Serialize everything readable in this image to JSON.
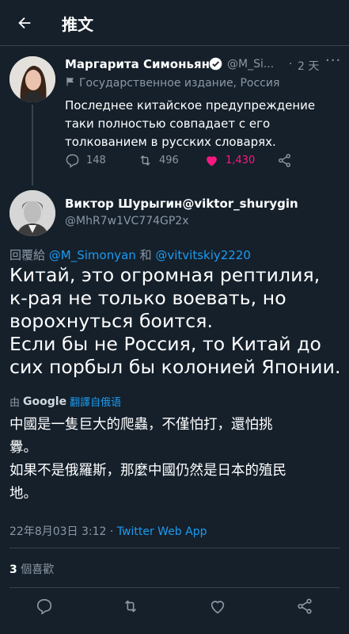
{
  "header": {
    "title": "推文"
  },
  "parent_tweet": {
    "author_name": "Маргарита Симоньян",
    "handle": "@M_Si...",
    "dot": "·",
    "time": "2 天",
    "more": "···",
    "label": "Государственное издание, Россия",
    "text": "Последнее китайское предупреждение таки полностью совпадает с его толкованием в русских словарях.",
    "replies": "148",
    "retweets": "496",
    "likes": "1,430"
  },
  "main_tweet": {
    "author_name": "Виктор Шурыгин@viktor_shurygin",
    "handle": "@MhR7w1VC774GP2x",
    "reply_prefix": "回覆給 ",
    "reply_user1": "@M_Simonyan",
    "reply_and": " 和 ",
    "reply_user2": "@vitvitskiy2220",
    "text_line1": "Китай, это огромная рептилия,",
    "text_line2": "к-рая не только воевать, но",
    "text_line3": "ворохнуться боится.",
    "text_line4": "Если бы не Россия, то Китай до",
    "text_line5": "сих порбыл бы колонией Японии.",
    "translated_by": "由",
    "google": "Google",
    "translate_link": "翻譯自俄语",
    "trans_line1": "中國是一隻巨大的爬蟲，不僅怕打，還怕挑",
    "trans_line2": "釁。",
    "trans_line3": "如果不是俄羅斯，那麼中國仍然是日本的殖民",
    "trans_line4": "地。",
    "date": "22年8月03日 3:12",
    "dot": " · ",
    "source": "Twitter Web App",
    "likes_count": "3",
    "likes_label": " 個喜歡"
  },
  "colors": {
    "background": "#15202b",
    "accent": "#1d9bf0",
    "like": "#f91880",
    "muted": "#8b98a5",
    "border": "#38444d"
  }
}
